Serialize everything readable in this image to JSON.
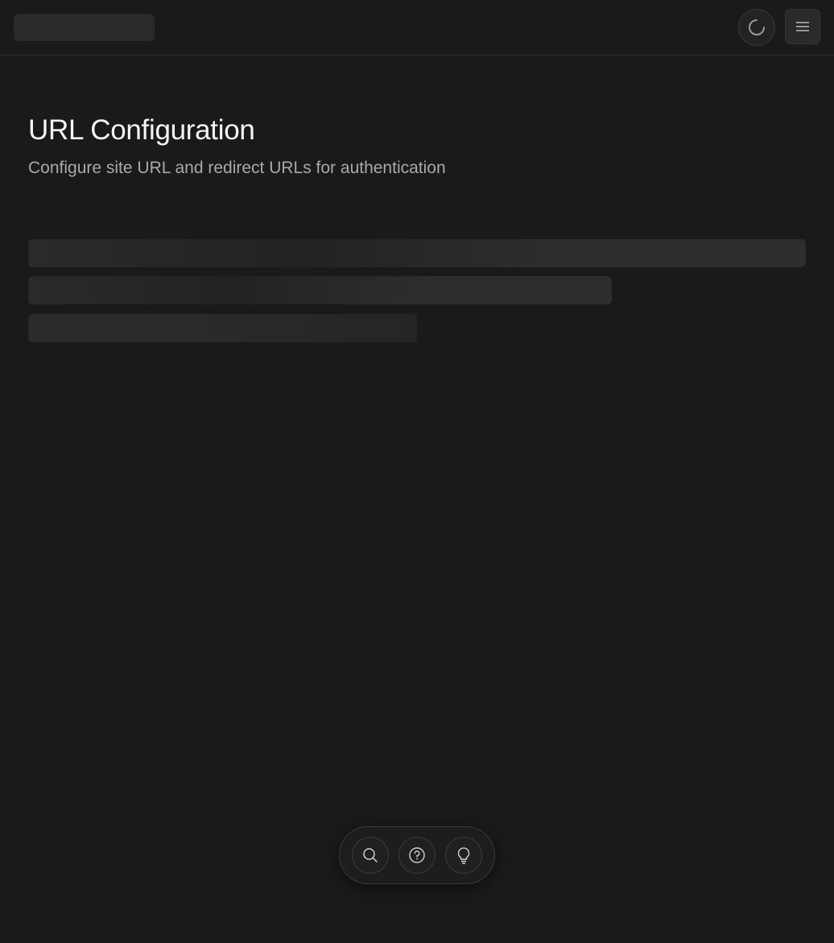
{
  "header": {
    "loading_icon": "loading-spinner-icon",
    "menu_icon": "hamburger-menu-icon"
  },
  "main": {
    "title": "URL Configuration",
    "subtitle": "Configure site URL and redirect URLs for authentication"
  },
  "toolbar": {
    "buttons": [
      {
        "icon": "search-icon"
      },
      {
        "icon": "help-circle-icon"
      },
      {
        "icon": "lightbulb-icon"
      }
    ]
  },
  "colors": {
    "background": "#1a1a1a",
    "skeleton": "#2a2a2a",
    "text_primary": "#f5f5f5",
    "text_secondary": "#a9a9a9"
  }
}
